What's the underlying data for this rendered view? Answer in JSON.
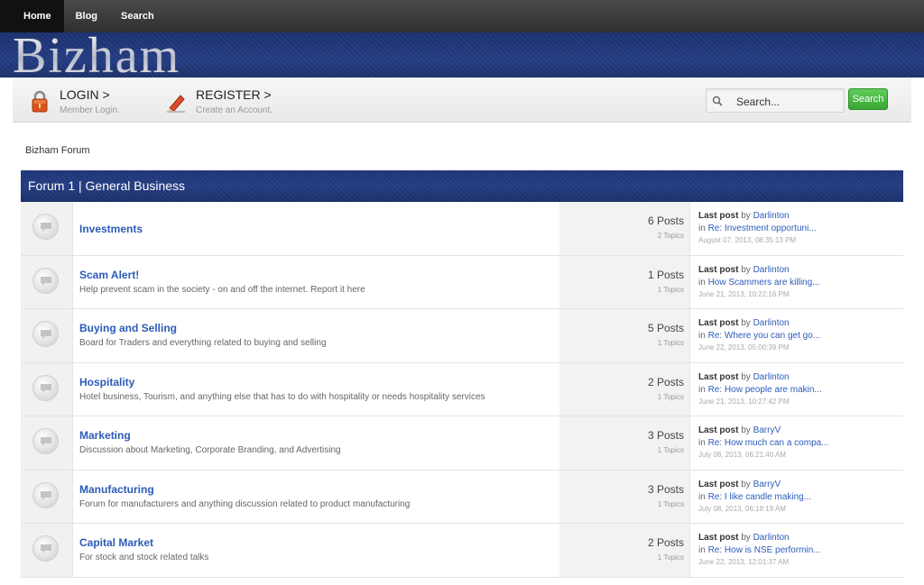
{
  "nav": {
    "items": [
      {
        "label": "Home"
      },
      {
        "label": "Blog"
      },
      {
        "label": "Search"
      }
    ]
  },
  "brand": {
    "logo": "Bizham"
  },
  "login": {
    "title": "LOGIN >",
    "subtitle": "Member Login."
  },
  "register": {
    "title": "REGISTER >",
    "subtitle": "Create an Account."
  },
  "search": {
    "placeholder": "Search...",
    "button": "Search"
  },
  "breadcrumb": "Bizham Forum",
  "category": {
    "title": "Forum 1 | General Business"
  },
  "forums": [
    {
      "name": "Investments",
      "description": "",
      "posts": "6 Posts",
      "topics": "2 Topics",
      "last_post_label": "Last post",
      "by": "by",
      "author": "Darlinton",
      "in": "in",
      "thread": "Re: Investment opportuni...",
      "date": "August 07, 2013, 08:35:13 PM"
    },
    {
      "name": "Scam Alert!",
      "description": "Help prevent scam in the society - on and off the internet. Report it here",
      "posts": "1 Posts",
      "topics": "1 Topics",
      "last_post_label": "Last post",
      "by": "by",
      "author": "Darlinton",
      "in": "in",
      "thread": "How Scammers are killing...",
      "date": "June 21, 2013, 10:22:16 PM"
    },
    {
      "name": "Buying and Selling",
      "description": "Board for Traders and everything related to buying and selling",
      "posts": "5 Posts",
      "topics": "1 Topics",
      "last_post_label": "Last post",
      "by": "by",
      "author": "Darlinton",
      "in": "in",
      "thread": "Re: Where you can get go...",
      "date": "June 22, 2013, 05:00:39 PM"
    },
    {
      "name": "Hospitality",
      "description": "Hotel business, Tourism, and anything else that has to do with hospitality or needs hospitality services",
      "posts": "2 Posts",
      "topics": "1 Topics",
      "last_post_label": "Last post",
      "by": "by",
      "author": "Darlinton",
      "in": "in",
      "thread": "Re: How people are makin...",
      "date": "June 21, 2013, 10:27:42 PM"
    },
    {
      "name": "Marketing",
      "description": "Discussion about Marketing, Corporate Branding, and Advertising",
      "posts": "3 Posts",
      "topics": "1 Topics",
      "last_post_label": "Last post",
      "by": "by",
      "author": "BarryV",
      "in": "in",
      "thread": "Re: How much can a compa...",
      "date": "July 08, 2013, 06:21:40 AM"
    },
    {
      "name": "Manufacturing",
      "description": "Forum for manufacturers and anything discussion related to product manufacturing",
      "posts": "3 Posts",
      "topics": "1 Topics",
      "last_post_label": "Last post",
      "by": "by",
      "author": "BarryV",
      "in": "in",
      "thread": "Re: I like candle making...",
      "date": "July 08, 2013, 06:18:19 AM"
    },
    {
      "name": "Capital Market",
      "description": "For stock and stock related talks",
      "posts": "2 Posts",
      "topics": "1 Topics",
      "last_post_label": "Last post",
      "by": "by",
      "author": "Darlinton",
      "in": "in",
      "thread": "Re: How is NSE performin...",
      "date": "June 22, 2013, 12:01:37 AM"
    }
  ],
  "colors": {
    "link": "#2d5bb8",
    "header_navy": "#223b80",
    "search_green": "#37a532"
  },
  "icons": {
    "login": "padlock-icon",
    "register": "pencil-icon",
    "search": "magnifier-icon",
    "forum": "speech-bubble-icon"
  }
}
